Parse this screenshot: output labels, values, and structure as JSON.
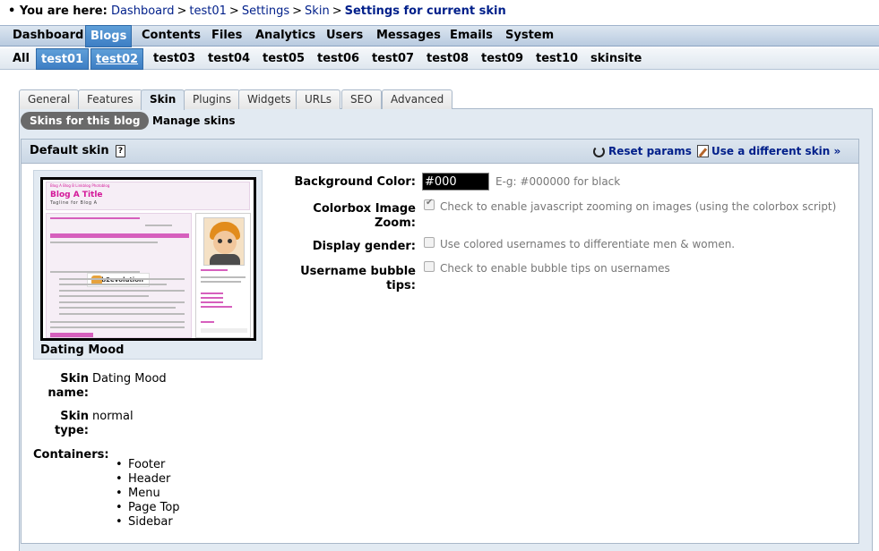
{
  "breadcrumb": {
    "prefix": "You are here:",
    "items": [
      "Dashboard",
      "test01",
      "Settings",
      "Skin"
    ],
    "current": "Settings for current skin"
  },
  "main_menu": [
    "Dashboard",
    "Blogs",
    "Contents",
    "Files",
    "Analytics",
    "Users",
    "Messages",
    "Emails",
    "System"
  ],
  "main_menu_active": "Blogs",
  "blog_menu": [
    "All",
    "test01",
    "test02",
    "test03",
    "test04",
    "test05",
    "test06",
    "test07",
    "test08",
    "test09",
    "test10",
    "skinsite"
  ],
  "blog_menu_active": [
    "test01",
    "test02"
  ],
  "tabs": [
    "General",
    "Features",
    "Skin",
    "Plugins",
    "Widgets",
    "URLs",
    "SEO",
    "Advanced"
  ],
  "tabs_active": "Skin",
  "subtabs": [
    "Skins for this blog",
    "Manage skins"
  ],
  "fieldset": {
    "title": "Default skin",
    "help_icon": "help-icon",
    "reset_label": "Reset params",
    "use_different_label": "Use a different skin »"
  },
  "thumbnail": {
    "nav": "Blog A   Blog B   Linkblog   Photoblog",
    "title": "Blog A Title",
    "tagline": "Tagline for Blog A",
    "logo_text": "b2evolution",
    "caption": "Dating Mood"
  },
  "info": {
    "skin_name_label": "Skin name:",
    "skin_name_value": "Dating Mood",
    "skin_type_label": "Skin type:",
    "skin_type_value": "normal",
    "containers_label": "Containers:",
    "containers": [
      "Footer",
      "Header",
      "Menu",
      "Page Top",
      "Sidebar"
    ]
  },
  "form": {
    "bg_color_label": "Background Color:",
    "bg_color_value": "#000",
    "bg_color_note": "E-g: #000000 for black",
    "colorbox_label_1": "Colorbox Image",
    "colorbox_label_2": "Zoom:",
    "colorbox_note": "Check to enable javascript zooming on images (using the colorbox script)",
    "colorbox_checked": true,
    "gender_label": "Display gender:",
    "gender_note": "Use colored usernames to differentiate men & women.",
    "gender_checked": false,
    "bubble_label_1": "Username bubble",
    "bubble_label_2": "tips:",
    "bubble_note": "Check to enable bubble tips on usernames",
    "bubble_checked": false
  },
  "colors": {
    "link": "#001f8a",
    "menu_active": "#3d7ec4",
    "panel_bg": "#e2eaf2"
  }
}
